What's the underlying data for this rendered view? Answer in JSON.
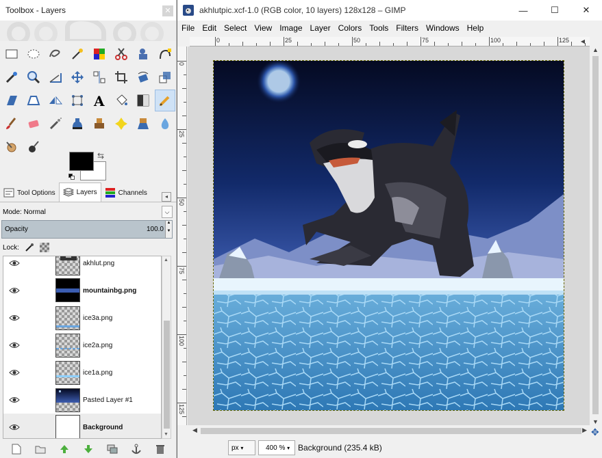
{
  "toolbox": {
    "title": "Toolbox - Layers",
    "close_icon": "close-icon",
    "dock_tabs": [
      {
        "label": "Tool Options",
        "icon": "tool-options-icon"
      },
      {
        "label": "Layers",
        "icon": "layers-icon"
      },
      {
        "label": "Channels",
        "icon": "channels-icon"
      }
    ],
    "mode_label": "Mode:",
    "mode_value": "Normal",
    "opacity_label": "Opacity",
    "opacity_value": "100.0",
    "lock_label": "Lock:",
    "layers": [
      {
        "name": "akhlut.png",
        "bold": false
      },
      {
        "name": "mountainbg.png",
        "bold": true
      },
      {
        "name": "ice3a.png",
        "bold": false
      },
      {
        "name": "ice2a.png",
        "bold": false
      },
      {
        "name": "ice1a.png",
        "bold": false
      },
      {
        "name": "Pasted Layer #1",
        "bold": false
      },
      {
        "name": "Background",
        "bold": true
      }
    ],
    "colors": {
      "foreground": "#000000",
      "background": "#ffffff",
      "accent_selection": "#cfe2f6"
    }
  },
  "image_window": {
    "title": "akhlutpic.xcf-1.0 (RGB color, 10 layers) 128x128 – GIMP",
    "window_controls": {
      "minimize": "—",
      "maximize": "☐",
      "close": "✕"
    },
    "menu": [
      "File",
      "Edit",
      "Select",
      "View",
      "Image",
      "Layer",
      "Colors",
      "Tools",
      "Filters",
      "Windows",
      "Help"
    ],
    "ruler_h_labels": [
      "0",
      "25",
      "50",
      "75",
      "100",
      "125"
    ],
    "ruler_v_labels": [
      "0",
      "25",
      "50",
      "75",
      "100",
      "125"
    ],
    "unit": "px",
    "zoom": "400 %",
    "status": "Background (235.4 kB)"
  }
}
